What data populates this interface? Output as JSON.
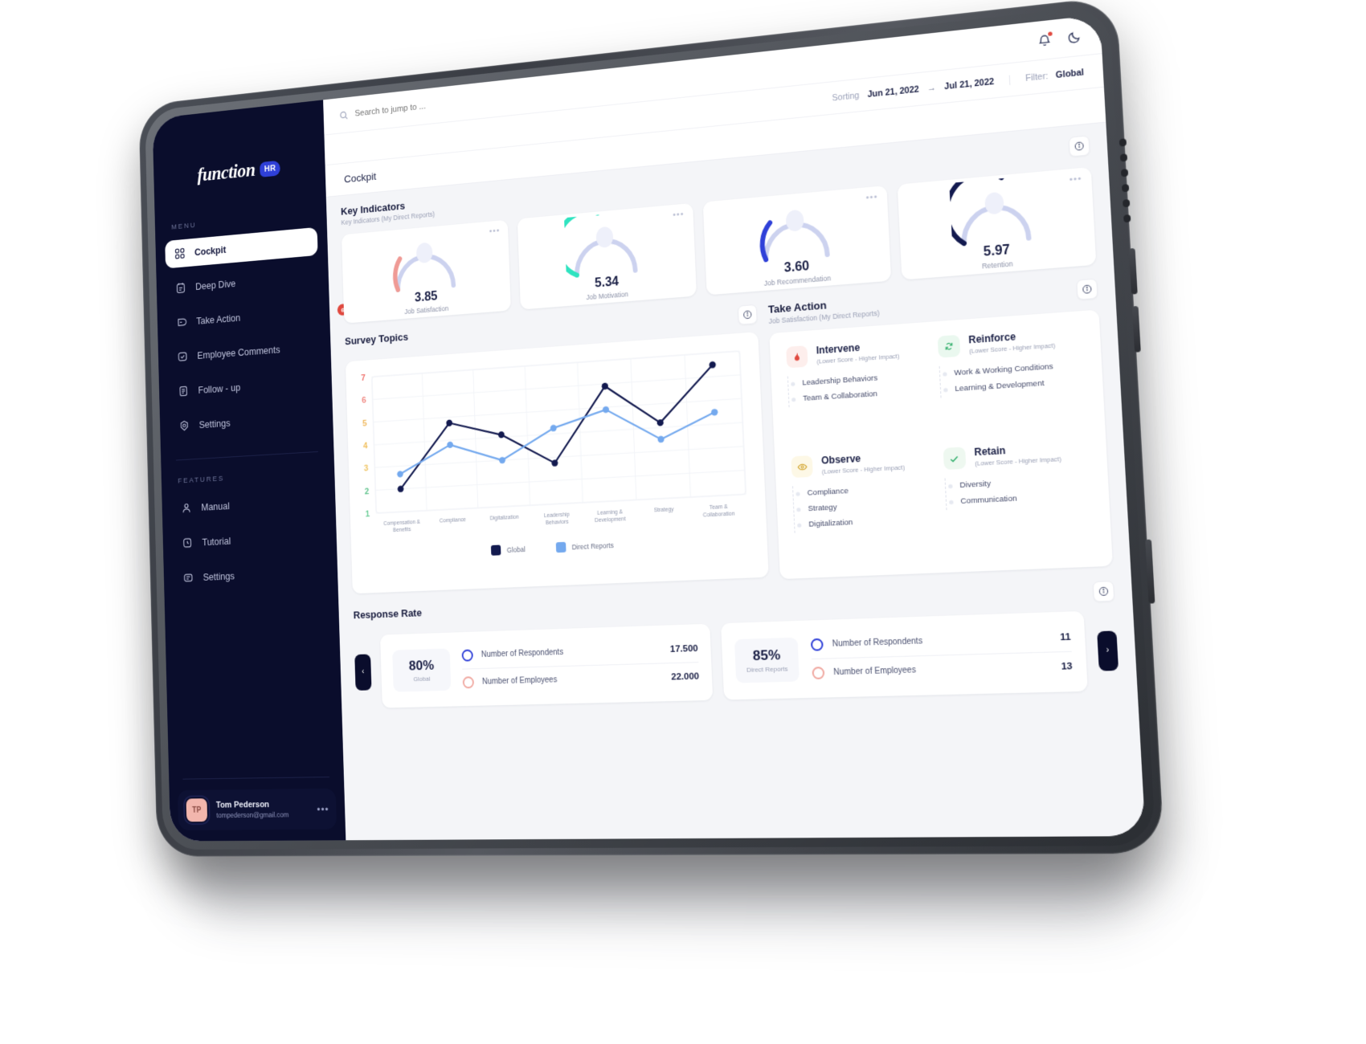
{
  "brand": {
    "name": "function",
    "badge": "HR"
  },
  "sidebar": {
    "menu_caption": "MENU",
    "menu_items": [
      {
        "label": "Cockpit",
        "icon": "grid-icon",
        "active": true,
        "badge": ""
      },
      {
        "label": "Deep Dive",
        "icon": "clipboard-icon",
        "active": false,
        "badge": ""
      },
      {
        "label": "Take Action",
        "icon": "action-icon",
        "active": false,
        "badge": "6"
      },
      {
        "label": "Employee Comments",
        "icon": "comment-check-icon",
        "active": false,
        "badge": ""
      },
      {
        "label": "Follow - up",
        "icon": "list-icon",
        "active": false,
        "badge": ""
      },
      {
        "label": "Settings",
        "icon": "gear-icon",
        "active": false,
        "badge": ""
      }
    ],
    "features_caption": "FEATURES",
    "feature_items": [
      {
        "label": "Manual",
        "icon": "user-icon"
      },
      {
        "label": "Tutorial",
        "icon": "clock-icon"
      },
      {
        "label": "Settings",
        "icon": "sliders-icon"
      }
    ],
    "profile": {
      "initials": "TP",
      "name": "Tom Pederson",
      "email": "tompederson@gmail.com",
      "menu": "•••"
    }
  },
  "topbar": {
    "search_placeholder": "Search to jump to ...",
    "notifications_icon": "bell-icon",
    "theme_icon": "moon-icon"
  },
  "subbar": {
    "sorting_label": "Sorting",
    "date_from": "Jun 21, 2022",
    "date_arrow": "→",
    "date_to": "Jul 21, 2022",
    "filter_label": "Filter:",
    "filter_value": "Global"
  },
  "breadcrumb": "Cockpit",
  "key_indicators": {
    "title": "Key Indicators",
    "subtitle": "Key Indicators (My Direct Reports)",
    "info_icon": "info-icon",
    "cards": [
      {
        "value": "3.85",
        "label": "Job Satisfaction",
        "color": "#ef9a95",
        "pct": 55,
        "menu": "•••"
      },
      {
        "value": "5.34",
        "label": "Job Motivation",
        "color": "#2fe3c0",
        "pct": 76,
        "menu": "•••"
      },
      {
        "value": "3.60",
        "label": "Job Recommendation",
        "color": "#2f40d8",
        "pct": 51,
        "menu": "•••"
      },
      {
        "value": "5.97",
        "label": "Retention",
        "color": "#131a4f",
        "pct": 85,
        "menu": "•••"
      }
    ]
  },
  "survey_topics": {
    "title": "Survey Topics",
    "info_icon": "info-icon"
  },
  "chart_data": {
    "type": "line",
    "title": "Survey Topics",
    "categories": [
      "Compensation & Benefits",
      "Compliance",
      "Digitalization",
      "Leadership Behaviors",
      "Learning & Development",
      "Strategy",
      "Team & Collaboration"
    ],
    "series": [
      {
        "name": "Global",
        "color": "#131a4f",
        "values": [
          2.0,
          4.75,
          4.1,
          2.75,
          5.9,
          4.2,
          6.5
        ]
      },
      {
        "name": "Direct Reports",
        "color": "#74a9ee",
        "values": [
          2.65,
          3.8,
          3.0,
          4.25,
          4.9,
          3.5,
          4.5
        ]
      }
    ],
    "ylim": [
      1,
      7
    ],
    "yticks": [
      7,
      6,
      5,
      4,
      3,
      2,
      1
    ],
    "ytick_colors": [
      "#ef6f6a",
      "#f08a84",
      "#f0b95f",
      "#f0c05f",
      "#efc565",
      "#63c48e",
      "#6fcf9a"
    ],
    "xlabel": "",
    "ylabel": "",
    "grid": true,
    "legend_position": "bottom"
  },
  "take_action": {
    "title": "Take Action",
    "subtitle": "Job Satisfaction (My Direct Reports)",
    "info_icon": "info-icon",
    "quadrants": [
      {
        "title": "Intervene",
        "subtitle": "(Lower Score - Higher Impact)",
        "icon": "fire-icon",
        "icon_color": "#e0493f",
        "icon_bg": "#fdeeec",
        "items": [
          "Leadership Behaviors",
          "Team & Collaboration"
        ]
      },
      {
        "title": "Reinforce",
        "subtitle": "(Lower Score - Higher Impact)",
        "icon": "refresh-icon",
        "icon_color": "#2fae6a",
        "icon_bg": "#eaf8ef",
        "items": [
          "Work & Working Conditions",
          "Learning & Development"
        ]
      },
      {
        "title": "Observe",
        "subtitle": "(Lower Score - Higher Impact)",
        "icon": "eye-icon",
        "icon_color": "#d1a227",
        "icon_bg": "#fdf8e6",
        "items": [
          "Compliance",
          "Strategy",
          "Digitalization"
        ]
      },
      {
        "title": "Retain",
        "subtitle": "(Lower Score - Higher Impact)",
        "icon": "check-icon",
        "icon_color": "#2fae6a",
        "icon_bg": "#eef8f0",
        "items": [
          "Diversity",
          "Communication"
        ]
      }
    ]
  },
  "response_rate": {
    "title": "Response Rate",
    "info_icon": "info-icon",
    "prev_arrow": "‹",
    "next_arrow": "›",
    "cards": [
      {
        "pct": "80%",
        "scope": "Global",
        "rows": [
          {
            "label": "Number of Respondents",
            "value": "17.500",
            "ring": "blue"
          },
          {
            "label": "Number of Employees",
            "value": "22.000",
            "ring": "pink"
          }
        ]
      },
      {
        "pct": "85%",
        "scope": "Direct Reports",
        "rows": [
          {
            "label": "Number of Respondents",
            "value": "11",
            "ring": "blue"
          },
          {
            "label": "Number of Employees",
            "value": "13",
            "ring": "pink"
          }
        ]
      }
    ]
  },
  "colors": {
    "sidebar_bg": "#0a0d2c",
    "accent": "#2f40d8",
    "danger": "#e0493f",
    "page_bg": "#f4f5f8"
  }
}
